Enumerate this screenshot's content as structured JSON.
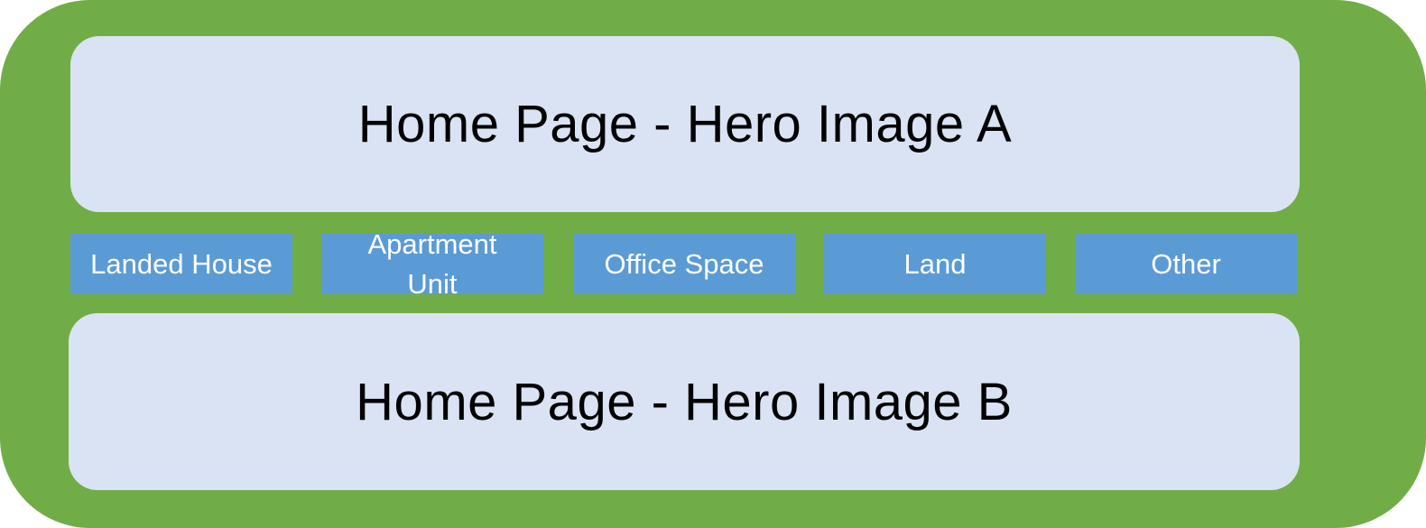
{
  "hero_top": {
    "label": "Home Page - Hero Image A"
  },
  "categories": [
    {
      "label": "Landed House"
    },
    {
      "label": "Apartment Unit"
    },
    {
      "label": "Office Space"
    },
    {
      "label": "Land"
    },
    {
      "label": "Other"
    }
  ],
  "hero_bottom": {
    "label": "Home Page - Hero Image B"
  },
  "colors": {
    "frame": "#70ad47",
    "hero_fill": "#dae3f3",
    "category_fill": "#5b9bd5",
    "category_text": "#ffffff",
    "hero_text": "#000000"
  }
}
